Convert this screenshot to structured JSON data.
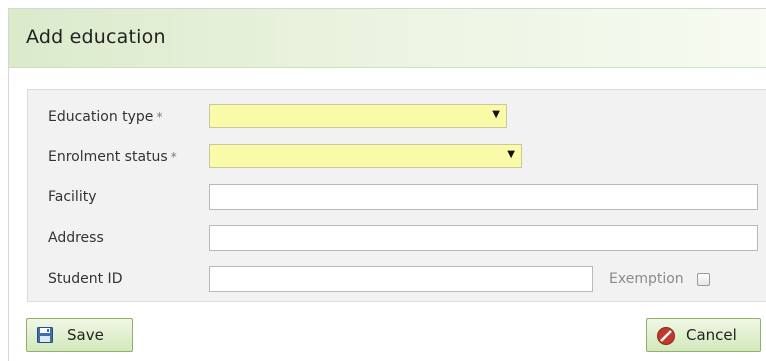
{
  "dialog": {
    "title": "Add education"
  },
  "form": {
    "education_type": {
      "label": "Education type",
      "required_mark": "*",
      "value": ""
    },
    "enrolment_status": {
      "label": "Enrolment status",
      "required_mark": "*",
      "value": ""
    },
    "facility": {
      "label": "Facility",
      "value": ""
    },
    "address": {
      "label": "Address",
      "value": ""
    },
    "student_id": {
      "label": "Student ID",
      "value": ""
    },
    "exemption": {
      "label": "Exemption",
      "checked": false
    }
  },
  "buttons": {
    "save": "Save",
    "cancel": "Cancel"
  },
  "colors": {
    "select_background": "#fbfaa8",
    "button_gradient_top": "#f0f7e6",
    "button_gradient_bottom": "#d3e8bb",
    "cancel_icon": "#c0392b",
    "save_icon": "#3d6fb0"
  },
  "icons": {
    "save": "floppy-disk-icon",
    "cancel": "no-entry-icon",
    "dropdown": "triangle-down-icon"
  }
}
